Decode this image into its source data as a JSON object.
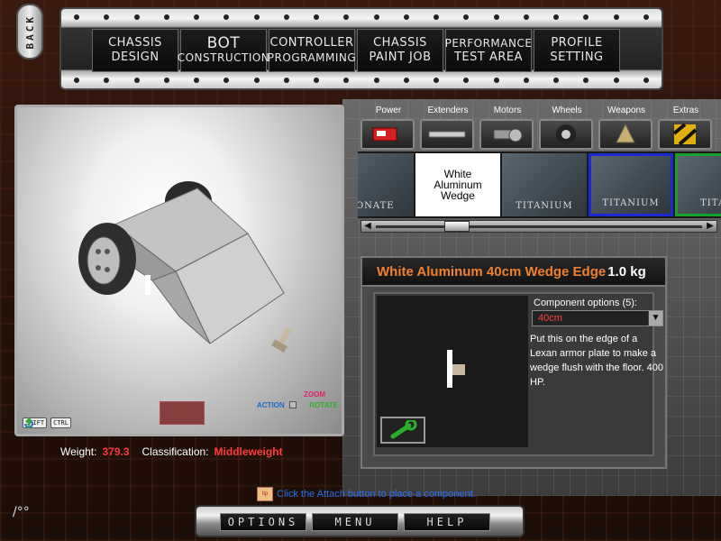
{
  "back_label": "BACK",
  "nav": [
    {
      "line1": "CHASSIS",
      "line2": "DESIGN",
      "style": "normal"
    },
    {
      "line1": "BOT",
      "line2": "CONSTRUCTION",
      "style": "bot"
    },
    {
      "line1": "CONTROLLER",
      "line2": "PROGRAMMING",
      "style": "normal"
    },
    {
      "line1": "CHASSIS",
      "line2": "PAINT JOB",
      "style": "normal"
    },
    {
      "line1": "PERFORMANCE",
      "line2": "TEST AREA",
      "style": "normal"
    },
    {
      "line1": "PROFILE",
      "line2": "SETTING",
      "style": "normal"
    }
  ],
  "viewport": {
    "shift_key": "SHIFT",
    "ctrl_key": "CTRL",
    "zoom_label": "ZOOM",
    "action_label": "ACTION",
    "rotate_label": "ROTATE"
  },
  "stats": {
    "weight_label": "Weight:",
    "weight_value": "379.3",
    "class_label": "Classification:",
    "class_value": "Middleweight"
  },
  "categories": [
    {
      "label": "Power",
      "icon": "battery-icon"
    },
    {
      "label": "Extenders",
      "icon": "extender-bar-icon"
    },
    {
      "label": "Motors",
      "icon": "motor-icon"
    },
    {
      "label": "Wheels",
      "icon": "wheel-icon"
    },
    {
      "label": "Weapons",
      "icon": "weapon-icon"
    },
    {
      "label": "Extras",
      "icon": "hazard-stripe-icon"
    }
  ],
  "carousel": {
    "cards": [
      {
        "label": "BONATE",
        "style": "plain"
      },
      {
        "label": "White Aluminum Wedge",
        "style": "selected"
      },
      {
        "label": "TITANIUM",
        "style": "plain"
      },
      {
        "label": "TITANIUM",
        "style": "blue"
      },
      {
        "label": "TITAN",
        "style": "green"
      }
    ]
  },
  "detail": {
    "title": "White Aluminum 40cm Wedge Edge",
    "weight": "1.0 kg",
    "options_label": "Component options (5):",
    "selected_option": "40cm",
    "description": "Put this on the edge of a Lexan armor plate to make a wedge flush with the floor.  400 HP."
  },
  "hint": {
    "tip_label": "tip",
    "text": "Click the Attach button to place a component."
  },
  "bottom": {
    "options": "OPTIONS",
    "menu": "MENU",
    "help": "HELP"
  },
  "colors": {
    "detail_title": "#f08030",
    "weight_value": "#ff3a3a",
    "hint_text": "#2a72e8",
    "selected_option": "#ff4040"
  }
}
